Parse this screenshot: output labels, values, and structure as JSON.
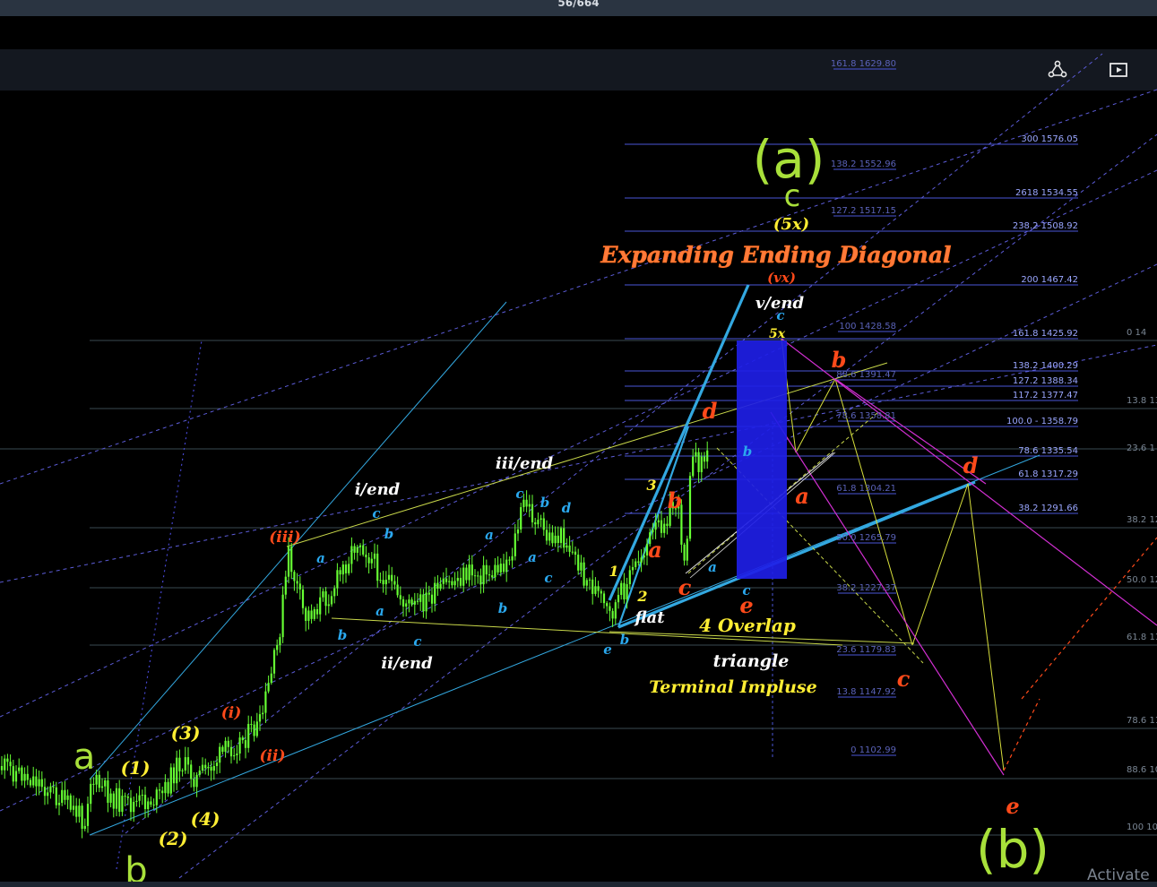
{
  "header": {
    "counter": "56/664",
    "activate_text": "Activate"
  },
  "toolbar": {
    "icons": [
      "share-icon",
      "present-icon"
    ]
  },
  "colors": {
    "bg": "#000000",
    "candle": "#66ff33",
    "cyan": "#33a8e0",
    "red": "#ff4a1a",
    "yellow": "#ffee33",
    "lime": "#b7ff3c",
    "white": "#ffffff",
    "blue_box": "#1e1ee6",
    "magenta": "#d22fd2",
    "olive": "#c9d84a",
    "fib_line": "#4a56d8",
    "fib_text": "#9aa6ff"
  },
  "chart_data": {
    "type": "candlestick",
    "title": "",
    "xlabel": "",
    "ylabel": "",
    "ylim": [
      1102.99,
      1629.8
    ],
    "grid": false,
    "fib_levels": [
      {
        "ratio": "161.8",
        "value": "1629.80",
        "text": "161.8 1629.80"
      },
      {
        "ratio": "300",
        "value": "1576.05",
        "text": "300 1576.05"
      },
      {
        "ratio": "138.2",
        "value": "1552.96",
        "text": "138.2 1552.96"
      },
      {
        "ratio": "2618",
        "value": "1534.55",
        "text": "2618 1534.55"
      },
      {
        "ratio": "127.2",
        "value": "1517.15",
        "text": "127.2 1517.15"
      },
      {
        "ratio": "238.2",
        "value": "1508.92",
        "text": "238.2 1508.92"
      },
      {
        "ratio": "200",
        "value": "1467.42",
        "text": "200 1467.42"
      },
      {
        "ratio": "100",
        "value": "1428.58",
        "text": "100 1428.58"
      },
      {
        "ratio": "161.8",
        "value": "1425.92",
        "text": "161.8 1425.92"
      },
      {
        "ratio": "138.2",
        "value": "1400.29",
        "text": "138.2 1400.29"
      },
      {
        "ratio": "88.6",
        "value": "1391.47",
        "text": "88.6 1391.47"
      },
      {
        "ratio": "127.2",
        "value": "1388.34",
        "text": "127.2 1388.34"
      },
      {
        "ratio": "117.2",
        "value": "1377.47",
        "text": "117.2 1377.47"
      },
      {
        "ratio": "78.6",
        "value": "1358.81",
        "text": "78.6 1358.81"
      },
      {
        "ratio": "100.0",
        "value": "1358.79",
        "text": "100.0 - 1358.79"
      },
      {
        "ratio": "78.6",
        "value": "1335.54",
        "text": "78.6 1335.54"
      },
      {
        "ratio": "61.8",
        "value": "1317.29",
        "text": "61.8 1317.29"
      },
      {
        "ratio": "61.8",
        "value": "1304.21",
        "text": "61.8 1304.21"
      },
      {
        "ratio": "38.2",
        "value": "1291.66",
        "text": "38.2 1291.66"
      },
      {
        "ratio": "50.0",
        "value": "1265.79",
        "text": "50.0 1265.79"
      },
      {
        "ratio": "38.2",
        "value": "1227.37",
        "text": "38.2 1227.37"
      },
      {
        "ratio": "23.6",
        "value": "1179.83",
        "text": "23.6 1179.83"
      },
      {
        "ratio": "13.8",
        "value": "1147.92",
        "text": "13.8 1147.92"
      },
      {
        "ratio": "0",
        "value": "1102.99",
        "text": "0 1102.99"
      }
    ],
    "right_axis_labels": [
      "0 14",
      "13.8 13",
      "23.6 1",
      "38.2 12",
      "50.0 12",
      "61.8 11",
      "78.6 11",
      "88.6 10",
      "100 10"
    ],
    "wave_labels": [
      {
        "text": "a",
        "color": "lime"
      },
      {
        "text": "b",
        "color": "lime"
      },
      {
        "text": "(a)",
        "color": "lime"
      },
      {
        "text": "c",
        "color": "lime"
      },
      {
        "text": "(b)",
        "color": "lime"
      },
      {
        "text": "(1)",
        "color": "yellow"
      },
      {
        "text": "(2)",
        "color": "yellow"
      },
      {
        "text": "(3)",
        "color": "yellow"
      },
      {
        "text": "(4)",
        "color": "yellow"
      },
      {
        "text": "(5x)",
        "color": "yellow"
      },
      {
        "text": "5x",
        "color": "yellow"
      },
      {
        "text": "1",
        "color": "yellow"
      },
      {
        "text": "2",
        "color": "yellow"
      },
      {
        "text": "3",
        "color": "yellow"
      },
      {
        "text": "(i)",
        "color": "red"
      },
      {
        "text": "(ii)",
        "color": "red"
      },
      {
        "text": "(iii)",
        "color": "red"
      },
      {
        "text": "(vx)",
        "color": "red"
      }
    ],
    "annotations": [
      "Expanding Ending Diagonal",
      "v/end",
      "iii/end",
      "i/end",
      "ii/end",
      "flat",
      "4 Overlap",
      "triangle",
      "Terminal Impluse"
    ]
  }
}
